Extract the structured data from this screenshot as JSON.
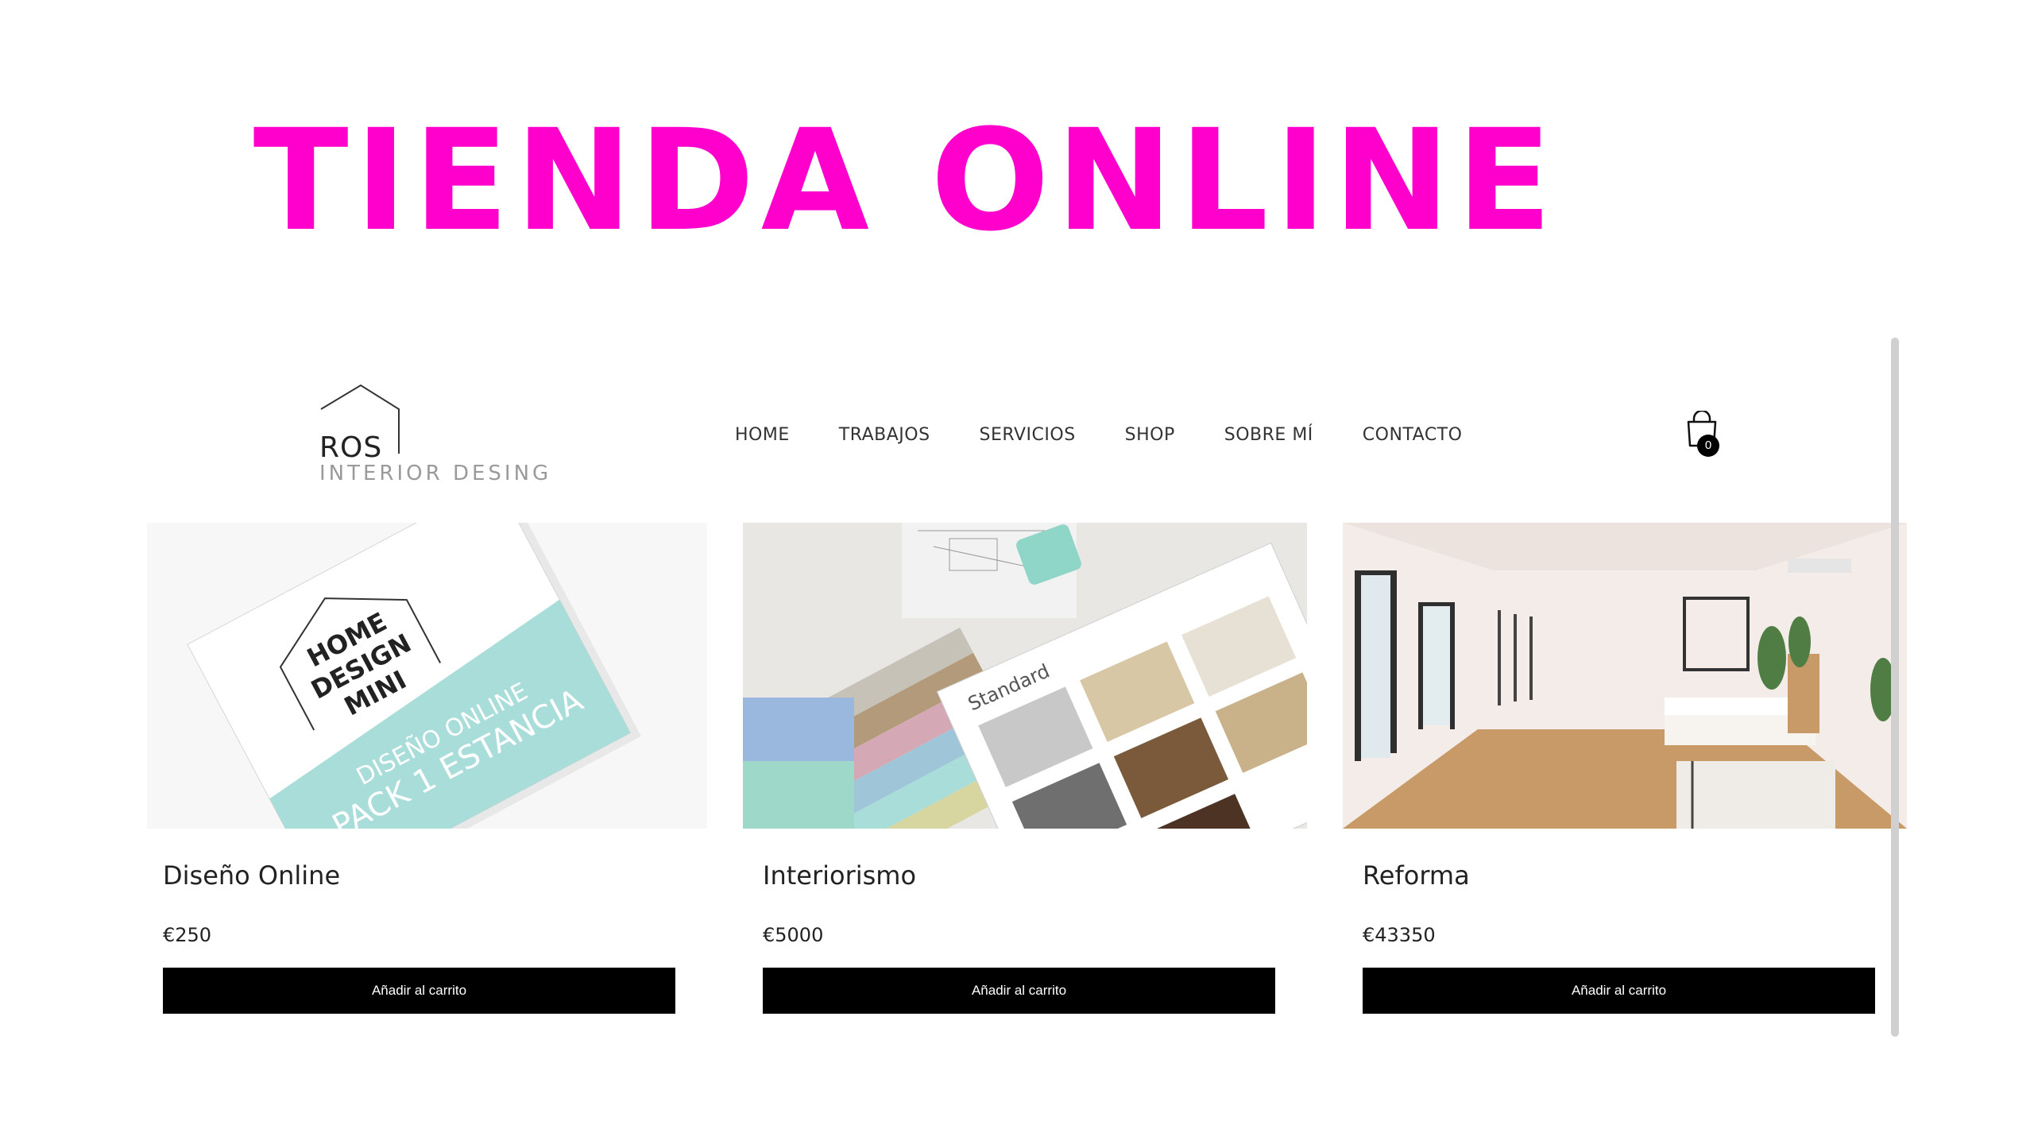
{
  "banner": {
    "title": "TIENDA ONLINE"
  },
  "logo": {
    "name": "ROS",
    "subtitle": "INTERIOR DESING"
  },
  "nav": {
    "items": [
      {
        "label": "HOME"
      },
      {
        "label": "TRABAJOS"
      },
      {
        "label": "SERVICIOS"
      },
      {
        "label": "SHOP"
      },
      {
        "label": "SOBRE MÍ"
      },
      {
        "label": "CONTACTO"
      }
    ]
  },
  "cart": {
    "icon": "shopping-bag-icon",
    "count": "0"
  },
  "products": [
    {
      "title": "Diseño Online",
      "price": "€250",
      "button": "Añadir al carrito",
      "image": {
        "box_line1": "HOME",
        "box_line2": "DESIGN",
        "box_line3": "MINI",
        "box_line4": "DISEÑO ONLINE",
        "box_line5": "PACK 1 ESTANCIA"
      }
    },
    {
      "title": "Interiorismo",
      "price": "€5000",
      "button": "Añadir al carrito",
      "image": {
        "sample_label": "Standard"
      }
    },
    {
      "title": "Reforma",
      "price": "€43350",
      "button": "Añadir al carrito",
      "image": {}
    }
  ],
  "colors": {
    "accent": "#ff00cc",
    "button_bg": "#000000",
    "button_text": "#ffffff",
    "aqua": "#a9ddd9"
  }
}
